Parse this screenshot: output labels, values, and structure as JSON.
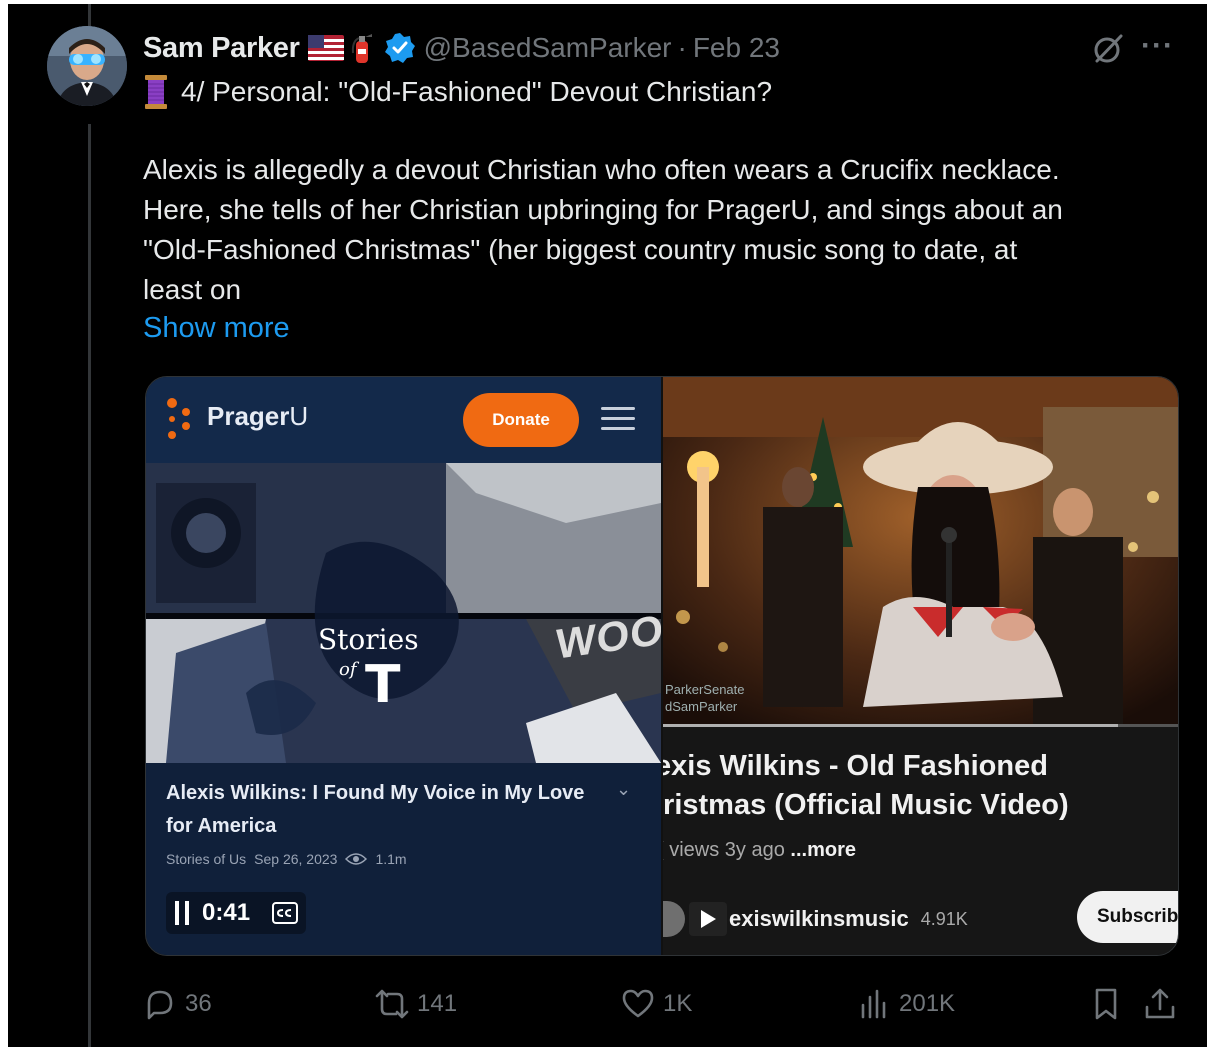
{
  "tweet": {
    "author_name": "Sam Parker",
    "handle": "@BasedSamParker",
    "separator": "·",
    "date": "Feb 23",
    "more_label": "···",
    "line1": "4/ Personal: \"Old-Fashioned\" Devout Christian?",
    "body_lines": [
      "Alexis is allegedly a devout Christian who often wears a Crucifix necklace.",
      "Here, she tells of her Christian upbringing for PragerU, and sings about an",
      "\"Old-Fashioned Christmas\" (her biggest country music song to date, at",
      "least on"
    ],
    "show_more": "Show more",
    "accent_color": "#1d9bf0",
    "icons": [
      "us-flag-icon",
      "fire-extinguisher-icon",
      "verified-badge-icon",
      "grok-icon",
      "more-icon",
      "thread-spool-icon"
    ]
  },
  "media_left": {
    "brand": "Prager",
    "brand_suffix": "U",
    "donate_label": "Donate",
    "thumbnail_title": "Stories",
    "thumbnail_of": "of",
    "thumbnail_t": "T",
    "thumbnail_sign": "WOOD",
    "video_title": "Alexis Wilkins: I Found My Voice in My Love for America",
    "channel": "Stories of Us",
    "published": "Sep 26, 2023",
    "views": "1.1m",
    "time": "0:41",
    "chevron": "⌄",
    "brand_color": "#f06a12"
  },
  "media_right": {
    "watermark_1": "ParkerSenate",
    "watermark_2": "dSamParker",
    "progress": 0.88,
    "title_line1": "exis Wilkins - Old Fashioned",
    "title_line2": "iristmas (Official Music Video)",
    "meta_views": "( views",
    "meta_age": "3y ago",
    "meta_more": "...more",
    "channel": "exiswilkinsmusic",
    "subs": "4.91K",
    "subscribe_label": "Subscrib"
  },
  "actions": {
    "replies": "36",
    "reposts": "141",
    "likes": "1K",
    "views": "201K"
  }
}
